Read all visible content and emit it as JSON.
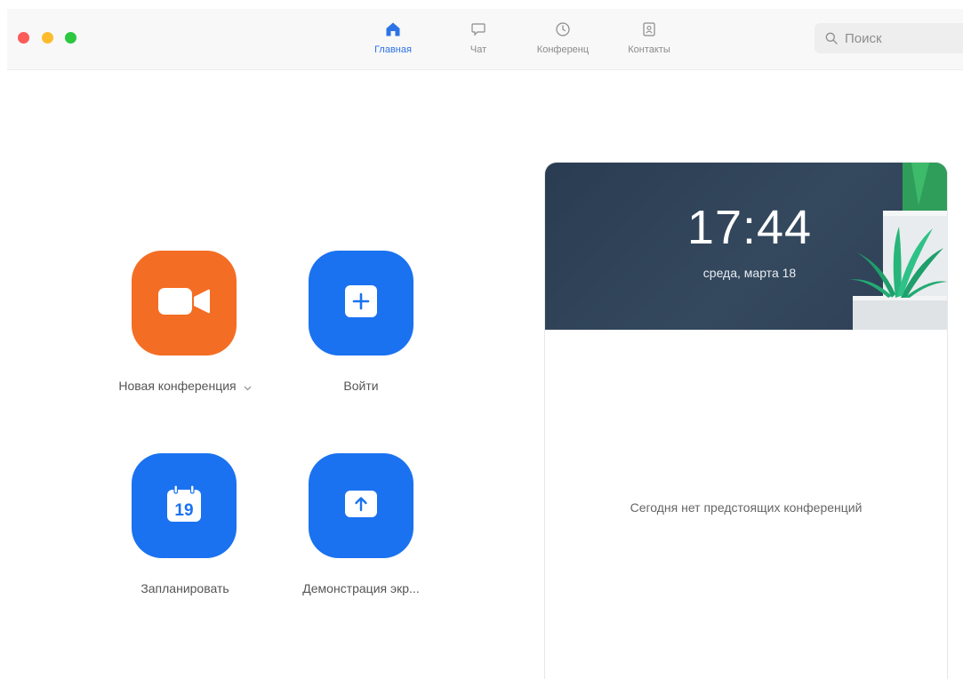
{
  "window": {
    "traffic_lights": {
      "close": "#fc5c57",
      "minimize": "#fdbc2e",
      "maximize": "#2cc840"
    }
  },
  "tabs": [
    {
      "label": "Главная",
      "icon": "home-icon",
      "active": true
    },
    {
      "label": "Чат",
      "icon": "chat-icon",
      "active": false
    },
    {
      "label": "Конференц",
      "icon": "clock-icon",
      "active": false
    },
    {
      "label": "Контакты",
      "icon": "contacts-icon",
      "active": false
    }
  ],
  "search": {
    "placeholder": "Поиск",
    "icon": "search-icon"
  },
  "actions": [
    {
      "label": "Новая конференция",
      "icon": "video-camera-icon",
      "color": "#f46d24",
      "has_dropdown": true
    },
    {
      "label": "Войти",
      "icon": "plus-icon",
      "color": "#1a72f0"
    },
    {
      "label": "Запланировать",
      "icon": "calendar-icon",
      "icon_text": "19",
      "color": "#1a72f0"
    },
    {
      "label": "Демонстрация экр...",
      "icon": "share-screen-icon",
      "color": "#1a72f0"
    }
  ],
  "card": {
    "time": "17:44",
    "date": "среда, марта 18",
    "empty_message": "Сегодня нет предстоящих конференций"
  },
  "colors": {
    "accent": "#2d73e6",
    "orange": "#f46d24",
    "blue": "#1a72f0",
    "header_bg": "#2f4258"
  }
}
